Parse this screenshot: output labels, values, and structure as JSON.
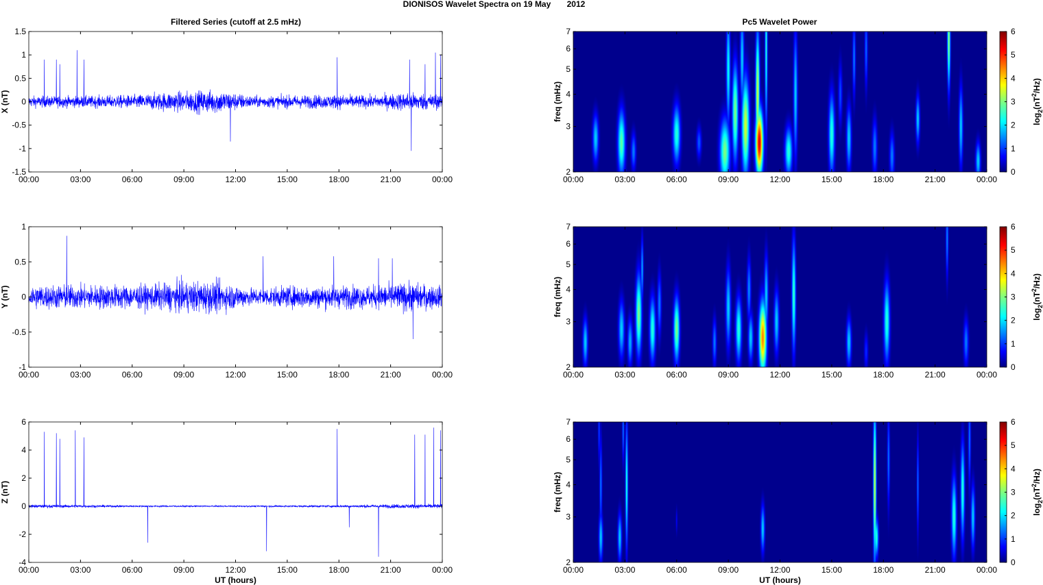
{
  "title": "DIONISOS Wavelet Spectra on 19 May       2012",
  "left_title": "Filtered Series (cutoff at 2.5 mHz)",
  "right_title": "Pc5 Wavelet Power",
  "chart_data": [
    {
      "type": "line",
      "component": "X",
      "ylabel": "X (nT)",
      "ylim": [
        -1.5,
        1.5
      ],
      "yticks": [
        "-1.5",
        "-1",
        "-0.5",
        "0",
        "0.5",
        "1",
        "1.5"
      ],
      "ytick_values": [
        -1.5,
        -1,
        -0.5,
        0,
        0.5,
        1,
        1.5
      ],
      "xlim": [
        0,
        24
      ],
      "xticks": [
        "00:00",
        "03:00",
        "06:00",
        "09:00",
        "12:00",
        "15:00",
        "18:00",
        "21:00",
        "00:00"
      ],
      "xlabel": "",
      "noise_amplitude_nT": [
        [
          0,
          0.12
        ],
        [
          3,
          0.12
        ],
        [
          6,
          0.14
        ],
        [
          8,
          0.2
        ],
        [
          11,
          0.25
        ],
        [
          13,
          0.12
        ],
        [
          16,
          0.14
        ],
        [
          18,
          0.15
        ],
        [
          20,
          0.13
        ],
        [
          22,
          0.2
        ],
        [
          24,
          0.15
        ]
      ],
      "spikes": [
        [
          0.9,
          0.9
        ],
        [
          1.6,
          0.9
        ],
        [
          1.8,
          0.8
        ],
        [
          2.8,
          1.1
        ],
        [
          3.2,
          0.9
        ],
        [
          11.7,
          -0.85
        ],
        [
          17.9,
          0.95
        ],
        [
          22.1,
          0.9
        ],
        [
          22.2,
          -1.05
        ],
        [
          23.0,
          0.8
        ],
        [
          23.6,
          1.05
        ],
        [
          23.9,
          1.0
        ]
      ],
      "color": "#0000ff"
    },
    {
      "type": "line",
      "component": "Y",
      "ylabel": "Y (nT)",
      "ylim": [
        -1,
        1
      ],
      "yticks": [
        "-1",
        "-0.5",
        "0",
        "0.5",
        "1"
      ],
      "ytick_values": [
        -1,
        -0.5,
        0,
        0.5,
        1
      ],
      "xlim": [
        0,
        24
      ],
      "xticks": [
        "00:00",
        "03:00",
        "06:00",
        "09:00",
        "12:00",
        "15:00",
        "18:00",
        "21:00",
        "00:00"
      ],
      "xlabel": "",
      "noise_amplitude_nT": [
        [
          0,
          0.17
        ],
        [
          4,
          0.17
        ],
        [
          7,
          0.17
        ],
        [
          9,
          0.22
        ],
        [
          11,
          0.22
        ],
        [
          13,
          0.12
        ],
        [
          16,
          0.16
        ],
        [
          20,
          0.16
        ],
        [
          22,
          0.2
        ],
        [
          24,
          0.15
        ]
      ],
      "spikes": [
        [
          2.2,
          0.87
        ],
        [
          13.6,
          0.58
        ],
        [
          17.7,
          0.58
        ],
        [
          20.3,
          0.55
        ],
        [
          21.1,
          0.55
        ],
        [
          22.3,
          -0.6
        ]
      ],
      "color": "#0000ff"
    },
    {
      "type": "line",
      "component": "Z",
      "ylabel": "Z (nT)",
      "ylim": [
        -4,
        6
      ],
      "yticks": [
        "-4",
        "-2",
        "0",
        "2",
        "4",
        "6"
      ],
      "ytick_values": [
        -4,
        -2,
        0,
        2,
        4,
        6
      ],
      "xlim": [
        0,
        24
      ],
      "xticks": [
        "00:00",
        "03:00",
        "06:00",
        "09:00",
        "12:00",
        "15:00",
        "18:00",
        "21:00",
        "00:00"
      ],
      "xlabel": "UT (hours)",
      "noise_amplitude_nT": [
        [
          0,
          0.12
        ],
        [
          3,
          0.1
        ],
        [
          6,
          0.06
        ],
        [
          12,
          0.05
        ],
        [
          18,
          0.08
        ],
        [
          22,
          0.15
        ],
        [
          24,
          0.15
        ]
      ],
      "spikes": [
        [
          0.9,
          5.3
        ],
        [
          1.6,
          5.2
        ],
        [
          1.8,
          4.8
        ],
        [
          2.7,
          5.4
        ],
        [
          3.2,
          4.9
        ],
        [
          6.9,
          -2.6
        ],
        [
          13.8,
          -3.2
        ],
        [
          17.9,
          5.5
        ],
        [
          18.6,
          -1.5
        ],
        [
          20.3,
          -3.6
        ],
        [
          22.4,
          5.1
        ],
        [
          23.0,
          5.1
        ],
        [
          23.5,
          5.6
        ],
        [
          23.9,
          5.4
        ]
      ],
      "color": "#0000ff"
    },
    {
      "type": "heatmap",
      "component": "X",
      "ylabel": "freq (mHz)",
      "ylim": [
        2,
        7
      ],
      "yscale": "log",
      "yticks": [
        "2",
        "3",
        "4",
        "5",
        "6",
        "7"
      ],
      "ytick_values": [
        2,
        3,
        4,
        5,
        6,
        7
      ],
      "xlim": [
        0,
        24
      ],
      "xticks": [
        "00:00",
        "03:00",
        "06:00",
        "09:00",
        "12:00",
        "15:00",
        "18:00",
        "21:00",
        "00:00"
      ],
      "xlabel": "",
      "colorbar": {
        "label": "log2(nT^2/Hz)",
        "clim": [
          0,
          6
        ],
        "ticks": [
          "0",
          "1",
          "2",
          "3",
          "4",
          "5",
          "6"
        ]
      },
      "peaks": [
        [
          1.3,
          2.7,
          2,
          0.12,
          0.15
        ],
        [
          2.8,
          2.6,
          2.8,
          0.15,
          0.2
        ],
        [
          3.5,
          2.4,
          1.5,
          0.1,
          0.12
        ],
        [
          6.0,
          2.8,
          2.5,
          0.15,
          0.18
        ],
        [
          7.3,
          2.6,
          1.3,
          0.1,
          0.1
        ],
        [
          8.8,
          2.4,
          3,
          0.2,
          0.2
        ],
        [
          9.0,
          5.0,
          2.3,
          0.08,
          0.35
        ],
        [
          9.4,
          3.4,
          3,
          0.12,
          0.3
        ],
        [
          10.0,
          3.0,
          3.5,
          0.15,
          0.3
        ],
        [
          9.8,
          5.5,
          2,
          0.08,
          0.3
        ],
        [
          10.8,
          2.6,
          5.5,
          0.15,
          0.2
        ],
        [
          10.7,
          4,
          3.5,
          0.08,
          0.4
        ],
        [
          11.2,
          6,
          2.5,
          0.05,
          0.5
        ],
        [
          12.5,
          2.4,
          2.5,
          0.15,
          0.15
        ],
        [
          12.9,
          4,
          2,
          0.08,
          0.4
        ],
        [
          15.0,
          2.8,
          2.5,
          0.12,
          0.25
        ],
        [
          15.5,
          4,
          1.2,
          0.08,
          0.2
        ],
        [
          16.0,
          2.7,
          2,
          0.1,
          0.2
        ],
        [
          16.3,
          5.5,
          1.5,
          0.06,
          0.25
        ],
        [
          17.0,
          6,
          1.4,
          0.06,
          0.25
        ],
        [
          17.5,
          2.5,
          1.5,
          0.1,
          0.18
        ],
        [
          18.5,
          2.3,
          1.5,
          0.1,
          0.15
        ],
        [
          20.0,
          3.2,
          2,
          0.08,
          0.15
        ],
        [
          21.8,
          6.5,
          3.2,
          0.06,
          0.3
        ],
        [
          22.5,
          3,
          2,
          0.08,
          0.25
        ],
        [
          23.5,
          2.2,
          2,
          0.1,
          0.12
        ]
      ]
    },
    {
      "type": "heatmap",
      "component": "Y",
      "ylabel": "freq (mHz)",
      "ylim": [
        2,
        7
      ],
      "yscale": "log",
      "yticks": [
        "2",
        "3",
        "4",
        "5",
        "6",
        "7"
      ],
      "ytick_values": [
        2,
        3,
        4,
        5,
        6,
        7
      ],
      "xlim": [
        0,
        24
      ],
      "xticks": [
        "00:00",
        "03:00",
        "06:00",
        "09:00",
        "12:00",
        "15:00",
        "18:00",
        "21:00",
        "00:00"
      ],
      "xlabel": "",
      "colorbar": {
        "label": "log2(nT^2/Hz)",
        "clim": [
          0,
          6
        ],
        "ticks": [
          "0",
          "1",
          "2",
          "3",
          "4",
          "5",
          "6"
        ]
      },
      "peaks": [
        [
          0.7,
          2.5,
          2,
          0.1,
          0.15
        ],
        [
          2.8,
          2.8,
          2,
          0.12,
          0.18
        ],
        [
          3.3,
          2.5,
          1.8,
          0.1,
          0.15
        ],
        [
          3.8,
          3.2,
          3,
          0.12,
          0.25
        ],
        [
          4.0,
          4.8,
          1.8,
          0.05,
          0.2
        ],
        [
          4.6,
          2.8,
          2.5,
          0.12,
          0.2
        ],
        [
          5.0,
          3.5,
          1.5,
          0.08,
          0.2
        ],
        [
          6.0,
          2.8,
          3,
          0.12,
          0.2
        ],
        [
          8.2,
          2.5,
          1.5,
          0.08,
          0.15
        ],
        [
          9.0,
          3.4,
          2,
          0.1,
          0.25
        ],
        [
          9.6,
          2.8,
          2.5,
          0.12,
          0.2
        ],
        [
          10.3,
          2.6,
          2,
          0.1,
          0.15
        ],
        [
          10.2,
          4,
          1.6,
          0.08,
          0.2
        ],
        [
          11.0,
          2.6,
          4.5,
          0.15,
          0.22
        ],
        [
          11.2,
          3.8,
          2,
          0.08,
          0.25
        ],
        [
          11.8,
          3.0,
          2,
          0.1,
          0.2
        ],
        [
          12.8,
          3.8,
          2.6,
          0.08,
          0.35
        ],
        [
          16.0,
          2.5,
          2,
          0.1,
          0.15
        ],
        [
          17.0,
          2.3,
          1,
          0.08,
          0.12
        ],
        [
          18.2,
          3.0,
          2.5,
          0.12,
          0.25
        ],
        [
          21.7,
          6.3,
          1.6,
          0.05,
          0.25
        ],
        [
          22.8,
          2.5,
          1.5,
          0.1,
          0.15
        ]
      ]
    },
    {
      "type": "heatmap",
      "component": "Z",
      "ylabel": "freq (mHz)",
      "ylim": [
        2,
        7
      ],
      "yscale": "log",
      "yticks": [
        "2",
        "3",
        "4",
        "5",
        "6",
        "7"
      ],
      "ytick_values": [
        2,
        3,
        4,
        5,
        6,
        7
      ],
      "xlim": [
        0,
        24
      ],
      "xticks": [
        "00:00",
        "03:00",
        "06:00",
        "09:00",
        "12:00",
        "15:00",
        "18:00",
        "21:00",
        "00:00"
      ],
      "xlabel": "UT (hours)",
      "colorbar": {
        "label": "log2(nT^2/Hz)",
        "clim": [
          0,
          6
        ],
        "ticks": [
          "0",
          "1",
          "2",
          "3",
          "4",
          "5",
          "6"
        ]
      },
      "peaks": [
        [
          1.6,
          2.5,
          2,
          0.08,
          0.15
        ],
        [
          1.6,
          4,
          1.5,
          0.05,
          0.3
        ],
        [
          1.5,
          6.5,
          1.2,
          0.04,
          0.2
        ],
        [
          2.7,
          2.5,
          2,
          0.08,
          0.15
        ],
        [
          3.1,
          4,
          2.5,
          0.05,
          0.4
        ],
        [
          2.9,
          6.5,
          1.5,
          0.04,
          0.2
        ],
        [
          6.0,
          2.9,
          0.8,
          0.03,
          0.08
        ],
        [
          11.0,
          2.7,
          2,
          0.08,
          0.15
        ],
        [
          17.5,
          4,
          3.5,
          0.06,
          0.5
        ],
        [
          17.6,
          2.5,
          2.5,
          0.08,
          0.12
        ],
        [
          18.3,
          5,
          1.5,
          0.05,
          0.3
        ],
        [
          20.0,
          4,
          1.5,
          0.04,
          0.3
        ],
        [
          22.1,
          3.0,
          2.5,
          0.1,
          0.25
        ],
        [
          22.6,
          3.8,
          2.5,
          0.08,
          0.3
        ],
        [
          23.0,
          6,
          1.5,
          0.05,
          0.3
        ],
        [
          23.2,
          3,
          2,
          0.08,
          0.2
        ]
      ]
    }
  ]
}
